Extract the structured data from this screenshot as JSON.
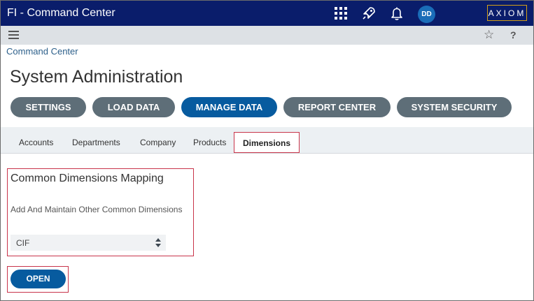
{
  "header": {
    "title": "FI - Command Center",
    "icons": [
      "apps-grid-icon",
      "rocket-icon",
      "bell-icon"
    ],
    "avatar": "DD",
    "logo": "AXIOM"
  },
  "subbar": {
    "icons": [
      "hamburger-menu-icon",
      "star-icon",
      "help-icon"
    ],
    "help_label": "?"
  },
  "breadcrumb": "Command Center",
  "page_title": "System Administration",
  "nav": [
    {
      "label": "SETTINGS",
      "active": false
    },
    {
      "label": "LOAD DATA",
      "active": false
    },
    {
      "label": "MANAGE DATA",
      "active": true
    },
    {
      "label": "REPORT CENTER",
      "active": false
    },
    {
      "label": "SYSTEM SECURITY",
      "active": false
    }
  ],
  "tabs": [
    {
      "label": "Accounts"
    },
    {
      "label": "Departments"
    },
    {
      "label": "Company"
    },
    {
      "label": "Products"
    },
    {
      "label": "Dimensions",
      "active": true
    }
  ],
  "card": {
    "title": "Common Dimensions Mapping",
    "description": "Add And Maintain Other Common Dimensions",
    "select_value": "CIF"
  },
  "open_label": "OPEN",
  "colors": {
    "topbar": "#0a1d6b",
    "accent_blue": "#075b9f",
    "nav_gray": "#5e6e78",
    "highlight": "#c8344a"
  }
}
